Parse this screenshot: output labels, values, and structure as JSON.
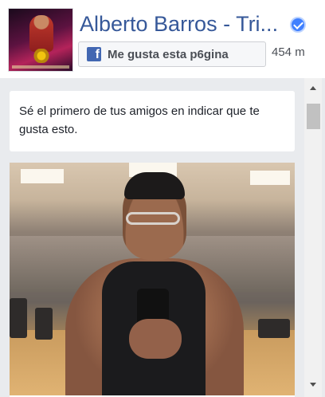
{
  "page": {
    "name": "Alberto Barros - Tri...",
    "verified": true
  },
  "like_button": {
    "icon": "facebook-f-icon",
    "label": "Me gusta esta p6gina"
  },
  "like_count": "454 m",
  "friends_prompt": "Sé el primero de tus amigos en indicar que te gusta esto.",
  "post": {
    "photo": "gym-selfie-photo"
  },
  "colors": {
    "link": "#365899",
    "verified": "#4080ff",
    "facebook_blue": "#4267b2",
    "feed_background": "#e9ebee"
  }
}
